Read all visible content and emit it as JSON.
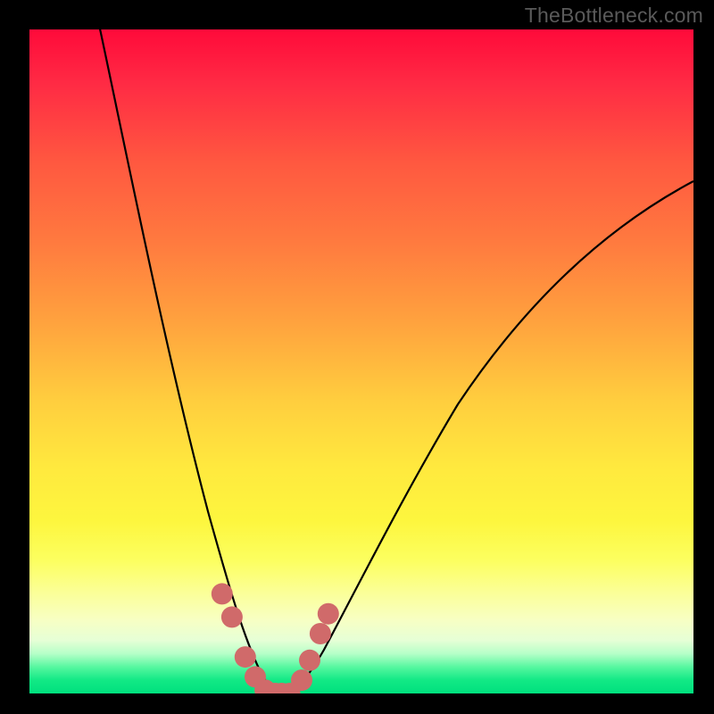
{
  "watermark": "TheBottleneck.com",
  "chart_data": {
    "type": "line",
    "title": "",
    "xlabel": "",
    "ylabel": "",
    "ylim": [
      0,
      100
    ],
    "x": [
      0,
      5,
      10,
      15,
      20,
      25,
      28,
      30,
      32,
      34,
      36,
      38,
      40,
      45,
      50,
      55,
      60,
      65,
      70,
      75,
      80,
      85,
      90,
      95,
      100
    ],
    "series": [
      {
        "name": "bottleneck-curve",
        "values": [
          110,
          95,
          80,
          65,
          50,
          35,
          25,
          18,
          10,
          4,
          0,
          0,
          0,
          10,
          20,
          30,
          38,
          45,
          52,
          58,
          63,
          68,
          72,
          75,
          78
        ]
      }
    ],
    "markers": {
      "name": "highlighted-points",
      "x_pct": [
        29.0,
        30.5,
        32.5,
        34.0,
        35.5,
        37.0,
        38.0,
        39.2,
        41.0,
        42.2,
        43.8,
        45.0
      ],
      "y_pct": [
        15.0,
        11.5,
        5.5,
        2.5,
        0.5,
        0.0,
        0.0,
        0.0,
        2.0,
        5.0,
        9.0,
        12.0
      ],
      "color": "#d06a6a",
      "radius_px": 12
    }
  }
}
